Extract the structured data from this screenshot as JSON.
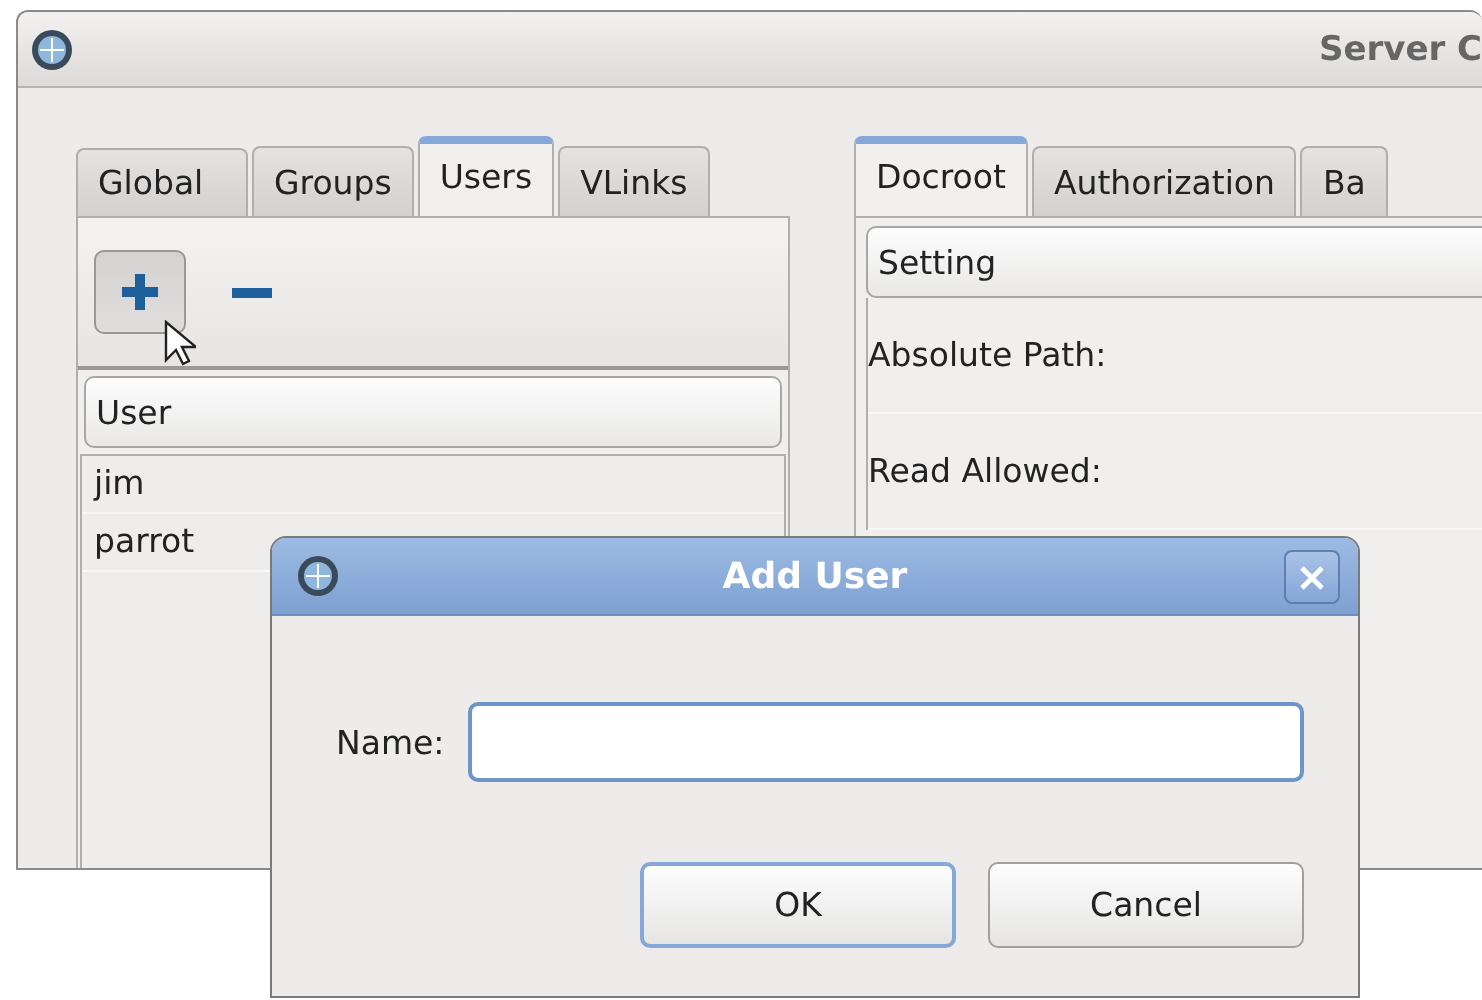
{
  "window": {
    "title": "Server C"
  },
  "left_tabs": [
    {
      "label": "Global",
      "selected": false
    },
    {
      "label": "Groups",
      "selected": false
    },
    {
      "label": "Users",
      "selected": true
    },
    {
      "label": "VLinks",
      "selected": false
    }
  ],
  "toolbar": {
    "buttons": [
      {
        "kind": "add",
        "pressed": true
      },
      {
        "kind": "remove",
        "pressed": false
      }
    ]
  },
  "user_list": {
    "column": "User",
    "rows": [
      "jim",
      "parrot"
    ]
  },
  "right_tabs": [
    {
      "label": "Docroot",
      "selected": true
    },
    {
      "label": "Authorization",
      "selected": false
    },
    {
      "label": "Ba",
      "selected": false
    }
  ],
  "settings": {
    "column": "Setting",
    "rows": [
      "Absolute Path:",
      "Read Allowed:"
    ]
  },
  "dialog": {
    "title": "Add User",
    "name_label": "Name:",
    "name_focused": true,
    "buttons": [
      {
        "label": "OK",
        "default": true
      },
      {
        "label": "Cancel",
        "default": false
      }
    ]
  }
}
